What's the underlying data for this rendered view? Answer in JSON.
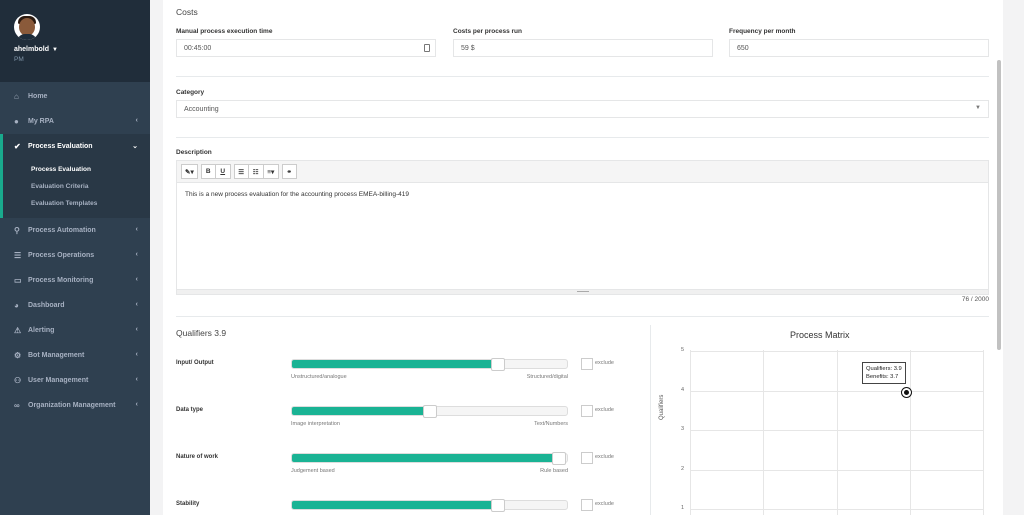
{
  "user": {
    "name": "ahelmbold",
    "role": "PM"
  },
  "sidebar": {
    "items": [
      {
        "label": "Home",
        "icon": "home-icon"
      },
      {
        "label": "My RPA",
        "icon": "user-icon"
      },
      {
        "label": "Process Evaluation",
        "icon": "check-icon",
        "active": true
      },
      {
        "label": "Process Automation",
        "icon": "sitemap-icon"
      },
      {
        "label": "Process Operations",
        "icon": "tasks-icon"
      },
      {
        "label": "Process Monitoring",
        "icon": "desktop-icon"
      },
      {
        "label": "Dashboard",
        "icon": "pie-chart-icon"
      },
      {
        "label": "Alerting",
        "icon": "warning-icon"
      },
      {
        "label": "Bot Management",
        "icon": "bot-icon"
      },
      {
        "label": "User Management",
        "icon": "users-icon"
      },
      {
        "label": "Organization Management",
        "icon": "link-icon"
      }
    ],
    "sub_items": [
      "Process Evaluation",
      "Evaluation Criteria",
      "Evaluation Templates"
    ]
  },
  "costs": {
    "title": "Costs",
    "manual_time_label": "Manual process execution time",
    "manual_time_value": "00:45:00",
    "cost_label": "Costs per process run",
    "cost_value": "59 $",
    "freq_label": "Frequency per month",
    "freq_value": "650"
  },
  "category": {
    "label": "Category",
    "value": "Accounting"
  },
  "description": {
    "label": "Description",
    "text": "This is a new process evaluation for the accounting process EMEA-billing-419",
    "counter": "76 / 2000"
  },
  "qualifiers": {
    "title": "Qualifiers 3.9",
    "exclude_label": "exclude",
    "rows": [
      {
        "label": "Input/ Output",
        "left": "Unstructured/analogue",
        "right": "Structured/digital",
        "value": 0.75
      },
      {
        "label": "Data type",
        "left": "Image interpretation",
        "right": "Text/Numbers",
        "value": 0.5
      },
      {
        "label": "Nature of work",
        "left": "Judgement based",
        "right": "Rule based",
        "value": 0.97
      },
      {
        "label": "Stability",
        "left": "",
        "right": "",
        "value": 0.75
      }
    ]
  },
  "chart_data": {
    "type": "scatter",
    "title": "Process Matrix",
    "ylabel": "Qualifiers",
    "yticks": [
      "5",
      "4",
      "3",
      "2",
      "1"
    ],
    "points": [
      {
        "x": 3.7,
        "y": 3.9
      }
    ],
    "tooltip_line1": "Qualifiers: 3.9",
    "tooltip_line2": "Benefits: 3.7"
  }
}
